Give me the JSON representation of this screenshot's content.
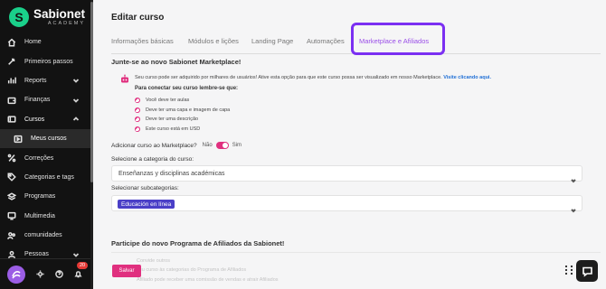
{
  "brand": {
    "name": "Sabionet",
    "sub": "ACADEMY"
  },
  "sidebar": {
    "items": [
      {
        "label": "Home",
        "icon": "home-icon"
      },
      {
        "label": "Primeiros passos",
        "icon": "rocket-icon"
      },
      {
        "label": "Reports",
        "icon": "reports-icon",
        "chevron": "down"
      },
      {
        "label": "Finanças",
        "icon": "wallet-icon",
        "chevron": "down"
      },
      {
        "label": "Cursos",
        "icon": "course-icon",
        "chevron": "up"
      },
      {
        "label": "Meus cursos",
        "icon": "play-icon"
      },
      {
        "label": "Correções",
        "icon": "percent-icon"
      },
      {
        "label": "Categorias e tags",
        "icon": "tag-icon"
      },
      {
        "label": "Programas",
        "icon": "layers-icon"
      },
      {
        "label": "Multimedia",
        "icon": "monitor-icon"
      },
      {
        "label": "comunidades",
        "icon": "community-icon"
      },
      {
        "label": "Pessoas",
        "icon": "people-icon",
        "chevron": "down"
      }
    ],
    "notification_count": "20"
  },
  "main": {
    "title": "Editar curso",
    "tabs": [
      {
        "label": "Informações básicas"
      },
      {
        "label": "Módulos e lições"
      },
      {
        "label": "Landing Page"
      },
      {
        "label": "Automações"
      },
      {
        "label": "Marketplace e Afiliados"
      }
    ],
    "marketplace": {
      "heading": "Junte-se ao novo Sabionet Marketplace!",
      "info_text": "Seu curso pode ser adquirido por milhares de usuários! Ative esta opção para que este curso possa ser visualizado em nosso Marketplace.",
      "info_link": "Visite clicando aqui.",
      "req_title": "Para conectar seu curso lembre-se que:",
      "requirements": [
        "Você deve ter aulas",
        "Deve ter uma capa e imagem de capa",
        "Deve ter uma descrição",
        "Este curso está em USD"
      ],
      "add_label": "Adicionar curso ao Marketplace?",
      "no_label": "Não",
      "yes_label": "Sim",
      "category_label": "Selecione a categoria do curso:",
      "category_value": "Enseñanzas y disciplinas académicas",
      "subcategory_label": "Selecionar subcategorias:",
      "subcategory_chip": "Educación en línea"
    },
    "affiliates": {
      "heading": "Participe do novo Programa de Afiliados da Sabionet!",
      "line1": "Convide outros",
      "line2": "seu curso às categorias do Programa de Afiliados",
      "line3": "Afiliado pode receber uma comissão de vendas e atrair Afiliados"
    },
    "save_label": "Salvar"
  },
  "colors": {
    "accent": "#9b4fe8",
    "pink": "#e0307f",
    "sidebar_bg": "#121212",
    "highlight": "#7b2ff2"
  }
}
